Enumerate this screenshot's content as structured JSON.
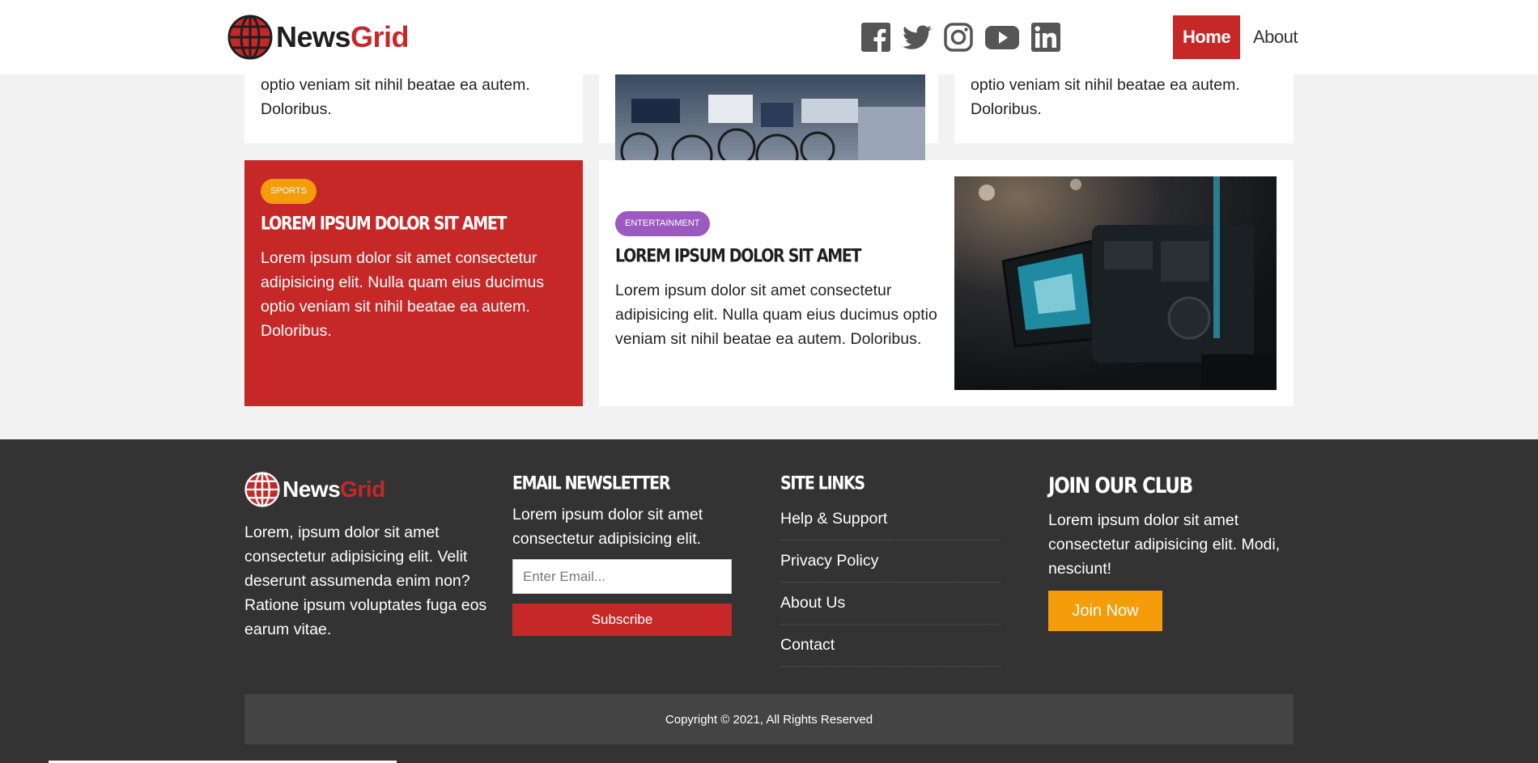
{
  "header": {
    "logo": {
      "part1": "News",
      "part2": "Grid"
    },
    "social_icons": [
      "facebook-icon",
      "twitter-icon",
      "instagram-icon",
      "youtube-icon",
      "linkedin-icon"
    ],
    "nav": {
      "home": "Home",
      "about": "About"
    }
  },
  "top_row": {
    "left_text": "optio veniam sit nihil beatae ea autem. Doloribus.",
    "right_text": "optio veniam sit nihil beatae ea autem. Doloribus."
  },
  "cards": {
    "sports": {
      "badge": "SPORTS",
      "title": "LOREM IPSUM DOLOR SIT AMET",
      "text": "Lorem ipsum dolor sit amet consectetur adipisicing elit. Nulla quam eius ducimus optio veniam sit nihil beatae ea autem. Doloribus."
    },
    "entertainment": {
      "badge": "ENTERTAINMENT",
      "title": "LOREM IPSUM DOLOR SIT AMET",
      "text": "Lorem ipsum dolor sit amet consectetur adipisicing elit. Nulla quam eius ducimus optio veniam sit nihil beatae ea autem. Doloribus."
    }
  },
  "footer": {
    "logo": {
      "part1": "News",
      "part2": "Grid"
    },
    "about_text": "Lorem, ipsum dolor sit amet consectetur adipisicing elit. Velit deserunt assumenda enim non? Ratione ipsum voluptates fuga eos earum vitae.",
    "newsletter": {
      "heading": "EMAIL NEWSLETTER",
      "text": "Lorem ipsum dolor sit amet consectetur adipisicing elit.",
      "placeholder": "Enter Email...",
      "button": "Subscribe"
    },
    "site_links": {
      "heading": "SITE LINKS",
      "items": [
        "Help & Support",
        "Privacy Policy",
        "About Us",
        "Contact"
      ]
    },
    "club": {
      "heading": "JOIN OUR CLUB",
      "text": "Lorem ipsum dolor sit amet consectetur adipisicing elit. Modi, nesciunt!",
      "button": "Join Now"
    },
    "copyright": "Copyright © 2021, All Rights Reserved"
  },
  "colors": {
    "brand_red": "#c62828",
    "accent_orange": "#f59c0b",
    "badge_purple": "#9c59c0",
    "footer_bg": "#333333"
  }
}
